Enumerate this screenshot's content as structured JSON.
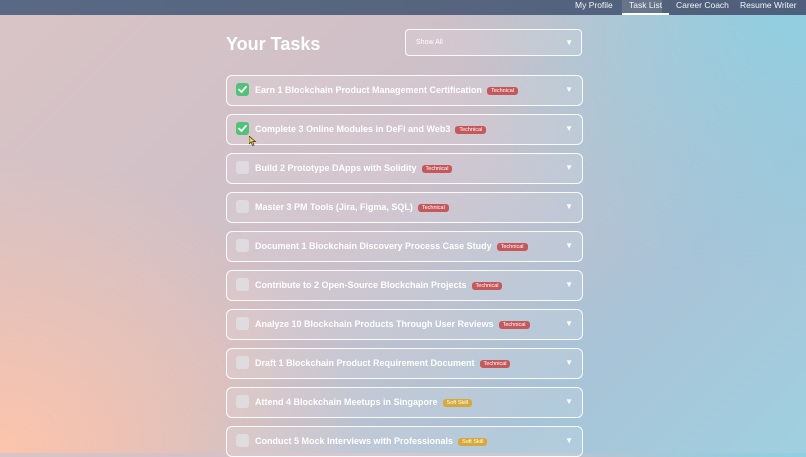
{
  "nav": {
    "items": [
      {
        "label": "My Profile",
        "active": false
      },
      {
        "label": "Task List",
        "active": true
      },
      {
        "label": "Career Coach",
        "active": false
      },
      {
        "label": "Resume Writer",
        "active": false
      }
    ]
  },
  "header": {
    "title": "Your Tasks",
    "filter_value": "Show All"
  },
  "tasks": [
    {
      "label": "Earn 1 Blockchain Product Management Certification",
      "tag": "Technical",
      "done": true
    },
    {
      "label": "Complete 3 Online Modules in DeFi and Web3",
      "tag": "Technical",
      "done": true
    },
    {
      "label": "Build 2 Prototype DApps with Solidity",
      "tag": "Technical",
      "done": false
    },
    {
      "label": "Master 3 PM Tools (Jira, Figma, SQL)",
      "tag": "Technical",
      "done": false
    },
    {
      "label": "Document 1 Blockchain Discovery Process Case Study",
      "tag": "Technical",
      "done": false
    },
    {
      "label": "Contribute to 2 Open-Source Blockchain Projects",
      "tag": "Technical",
      "done": false
    },
    {
      "label": "Analyze 10 Blockchain Products Through User Reviews",
      "tag": "Technical",
      "done": false
    },
    {
      "label": "Draft 1 Blockchain Product Requirement Document",
      "tag": "Technical",
      "done": false
    },
    {
      "label": "Attend 4 Blockchain Meetups in Singapore",
      "tag": "Soft Skill",
      "done": false
    },
    {
      "label": "Conduct 5 Mock Interviews with Professionals",
      "tag": "Soft Skill",
      "done": false
    }
  ],
  "colors": {
    "check_done": "#52c27a",
    "tag_technical": "#c4585a",
    "tag_soft_skill": "#d6a93a"
  },
  "icons": {
    "check": "check-icon",
    "expand": "chevron-down-icon",
    "filter_dropdown": "chevron-down-icon",
    "pointer": "cursor-icon"
  }
}
